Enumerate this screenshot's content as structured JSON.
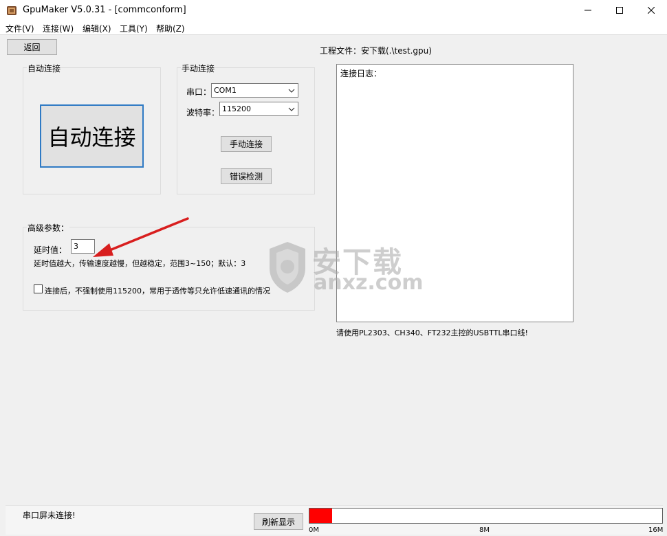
{
  "window": {
    "title": "GpuMaker V5.0.31 - [commconform]"
  },
  "menu": [
    "文件(V)",
    "连接(W)",
    "编辑(X)",
    "工具(Y)",
    "帮助(Z)"
  ],
  "toolbar": {
    "back_label": "返回",
    "project_file": "工程文件：安下载(.\\test.gpu)"
  },
  "auto_connect": {
    "group_label": "自动连接",
    "button_label": "自动连接"
  },
  "manual_connect": {
    "group_label": "手动连接",
    "port_label": "串口：",
    "port_value": "COM1",
    "baud_label": "波特率：",
    "baud_value": "115200",
    "connect_button": "手动连接",
    "error_check_button": "错误检测"
  },
  "advanced": {
    "group_label": "高级参数：",
    "delay_label": "延时值：",
    "delay_value": "3",
    "delay_hint": "延时值越大，传输速度越慢，但越稳定，范围3~150；默认：3",
    "checkbox_label": "连接后，不强制使用115200，常用于透传等只允许低速通讯的情况",
    "checkbox_checked": false
  },
  "log": {
    "title": "连接日志：",
    "note": "请使用PL2303、CH340、FT232主控的USBTTL串口线!"
  },
  "watermark": {
    "cn": "安下载",
    "en": "anxz.com"
  },
  "status": {
    "text": "串口屏未连接!",
    "refresh_button": "刷新显示",
    "progress_fraction": 0.065,
    "progress_color": "#ff0000",
    "scale": [
      "0M",
      "8M",
      "16M"
    ]
  },
  "colors": {
    "accent_border": "#2f7ac4",
    "annotation_arrow": "#d81e1e"
  },
  "icons": {
    "app": "gpumaker-app-icon",
    "minimize": "minimize-icon",
    "maximize": "maximize-icon",
    "close": "close-icon",
    "dropdown": "chevron-down-icon"
  }
}
